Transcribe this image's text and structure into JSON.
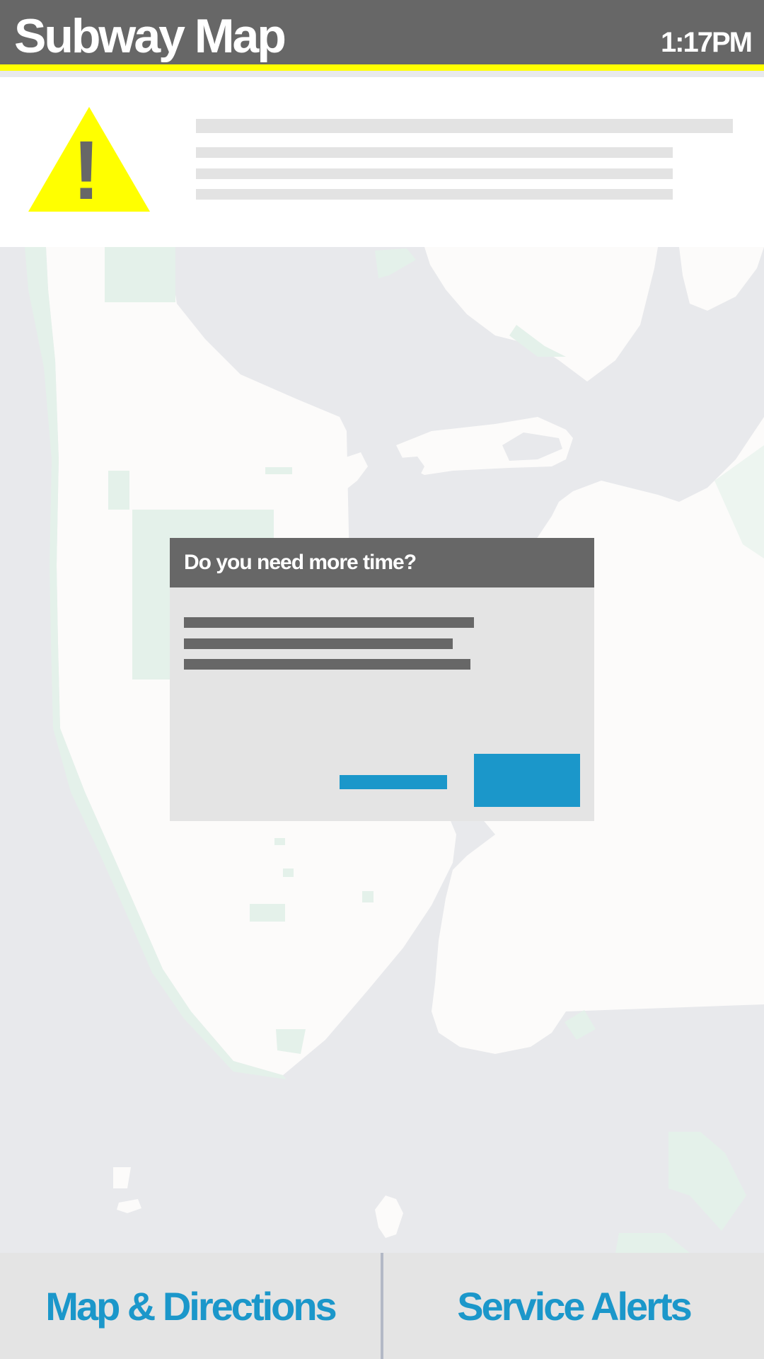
{
  "header": {
    "title": "Subway Map",
    "time": "1:17PM"
  },
  "alert_banner": {
    "icon": "warning-icon",
    "icon_color": "#ffff00",
    "icon_glyph": "!"
  },
  "dialog": {
    "title": "Do you need more time?"
  },
  "bottom_nav": {
    "tabs": [
      {
        "label": "Map & Directions"
      },
      {
        "label": "Service Alerts"
      }
    ]
  },
  "colors": {
    "header_bg": "#676767",
    "accent_yellow": "#ffff00",
    "link_blue": "#1b97ca",
    "water": "#e8e9ec",
    "land": "#fcfbfa",
    "park": "#e4f1ea"
  }
}
